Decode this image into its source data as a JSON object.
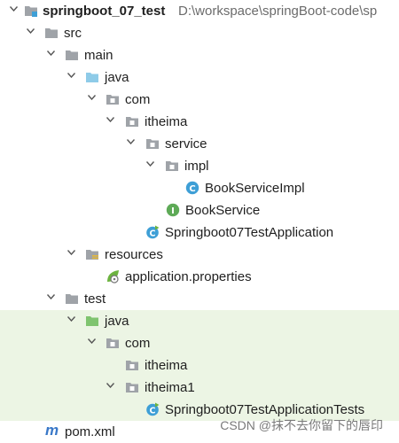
{
  "project": {
    "name": "springboot_07_test",
    "path": "D:\\workspace\\springBoot-code\\sp"
  },
  "tree": {
    "src": "src",
    "main": "main",
    "java": "java",
    "com": "com",
    "itheima": "itheima",
    "service": "service",
    "impl": "impl",
    "book_service_impl": "BookServiceImpl",
    "book_service": "BookService",
    "app_class": "Springboot07TestApplication",
    "resources": "resources",
    "app_properties": "application.properties",
    "test": "test",
    "test_java": "java",
    "test_com": "com",
    "test_itheima": "itheima",
    "test_itheima1": "itheima1",
    "app_tests_class": "Springboot07TestApplicationTests",
    "pom": "pom.xml"
  },
  "icons": {
    "class_badge": "C",
    "interface_badge": "I",
    "maven_badge": "m"
  },
  "colors": {
    "folder": "#9fa3a8",
    "source_folder": "#8ecbe8",
    "test_folder": "#7fc46f",
    "class_icon": "#3e9fd6",
    "interface_icon": "#5eaa57",
    "spring_green": "#6cb33f",
    "test_background": "#ecf5e4"
  },
  "watermark": "CSDN @抹不去你留下的唇印"
}
